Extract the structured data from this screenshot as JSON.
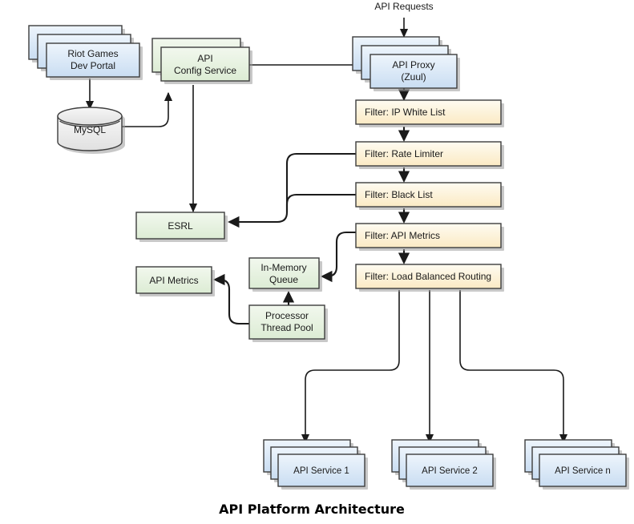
{
  "diagram": {
    "caption": "API Platform Architecture",
    "entry_label": "API Requests",
    "colors": {
      "blue_fill_top": "#eaf2fb",
      "blue_fill_bottom": "#c9ddf2",
      "green_fill_top": "#f0f7ec",
      "green_fill_bottom": "#dceed5",
      "cream_fill_top": "#fefaec",
      "cream_fill_bottom": "#fbeccb",
      "gray_fill_top": "#f5f5f5",
      "gray_fill_bottom": "#e2e2e2",
      "stroke": "#3d3d3d",
      "connector": "#1a1a1a",
      "shadow": "#9a9a9a",
      "text": "#1a1a1a"
    },
    "nodes": {
      "dev_portal": {
        "label_line1": "Riot Games",
        "label_line2": "Dev Portal",
        "type": "stack-blue"
      },
      "mysql": {
        "label": "MySQL",
        "type": "cylinder-gray"
      },
      "config_service": {
        "label_line1": "API",
        "label_line2": "Config Service",
        "type": "stack-green"
      },
      "esrl": {
        "label": "ESRL",
        "type": "box-green"
      },
      "api_metrics_store": {
        "label": "API Metrics",
        "type": "box-green"
      },
      "in_memory_queue": {
        "label_line1": "In-Memory",
        "label_line2": "Queue",
        "type": "box-green"
      },
      "processor_thread_pool": {
        "label_line1": "Processor",
        "label_line2": "Thread Pool",
        "type": "box-green"
      },
      "api_proxy": {
        "label_line1": "API Proxy",
        "label_line2": "(Zuul)",
        "type": "stack-blue"
      },
      "filter_ip_white_list": {
        "label": "Filter: IP White List",
        "type": "box-cream"
      },
      "filter_rate_limiter": {
        "label": "Filter: Rate Limiter",
        "type": "box-cream"
      },
      "filter_black_list": {
        "label": "Filter: Black List",
        "type": "box-cream"
      },
      "filter_api_metrics": {
        "label": "Filter: API Metrics",
        "type": "box-cream"
      },
      "filter_load_balanced_routing": {
        "label": "Filter: Load Balanced Routing",
        "type": "box-cream"
      },
      "api_service_1": {
        "label": "API Service 1",
        "type": "stack-blue"
      },
      "api_service_2": {
        "label": "API Service 2",
        "type": "stack-blue"
      },
      "api_service_n": {
        "label": "API Service n",
        "type": "stack-blue"
      }
    },
    "edges": [
      {
        "from": "dev_portal",
        "to": "mysql"
      },
      {
        "from": "mysql",
        "to": "config_service"
      },
      {
        "from": "config_service",
        "to": "esrl"
      },
      {
        "from": "api_proxy",
        "to": "config_service"
      },
      {
        "from": "api_proxy",
        "to": "filter_ip_white_list"
      },
      {
        "from": "filter_ip_white_list",
        "to": "filter_rate_limiter"
      },
      {
        "from": "filter_rate_limiter",
        "to": "filter_black_list"
      },
      {
        "from": "filter_rate_limiter",
        "to": "esrl"
      },
      {
        "from": "filter_black_list",
        "to": "esrl"
      },
      {
        "from": "filter_black_list",
        "to": "filter_api_metrics"
      },
      {
        "from": "filter_api_metrics",
        "to": "in_memory_queue"
      },
      {
        "from": "filter_api_metrics",
        "to": "filter_load_balanced_routing"
      },
      {
        "from": "processor_thread_pool",
        "to": "in_memory_queue"
      },
      {
        "from": "processor_thread_pool",
        "to": "api_metrics_store"
      },
      {
        "from": "filter_load_balanced_routing",
        "to": "api_service_1"
      },
      {
        "from": "filter_load_balanced_routing",
        "to": "api_service_2"
      },
      {
        "from": "filter_load_balanced_routing",
        "to": "api_service_n"
      }
    ]
  }
}
